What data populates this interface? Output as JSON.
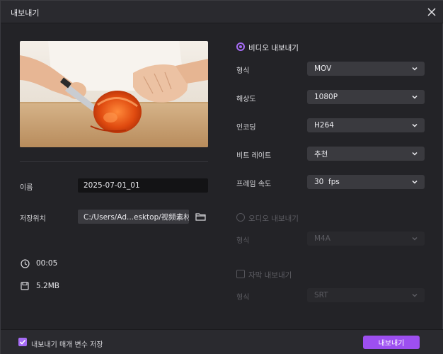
{
  "window": {
    "title": "내보내기"
  },
  "preview": {
    "description_icon": "video-thumbnail"
  },
  "fields": {
    "name_label": "이름",
    "name_value": "2025-07-01_01",
    "path_label": "저장위치",
    "path_value": "C:/Users/Ad...esktop/视频素材"
  },
  "info": {
    "duration": "00:05",
    "size": "5.2MB"
  },
  "video_export": {
    "title": "비디오 내보내기",
    "selected": true,
    "rows": [
      {
        "label": "형식",
        "value": "MOV"
      },
      {
        "label": "해상도",
        "value": "1080P"
      },
      {
        "label": "인코딩",
        "value": "H264"
      },
      {
        "label": "비트 레이트",
        "value": "추천"
      },
      {
        "label": "프레임 속도",
        "value": "30  fps"
      }
    ]
  },
  "audio_export": {
    "title": "오디오 내보내기",
    "selected": false,
    "format_label": "형식",
    "format_value": "M4A"
  },
  "subtitle_export": {
    "title": "자막 내보내기",
    "checked": false,
    "format_label": "형식",
    "format_value": "SRT"
  },
  "footer": {
    "save_params_label": "내보내기 매개 변수 저장",
    "save_params_checked": true,
    "export_button": "내보내기"
  },
  "colors": {
    "accent": "#a66cf5",
    "button": "#9d4ff0",
    "background": "#232327"
  }
}
